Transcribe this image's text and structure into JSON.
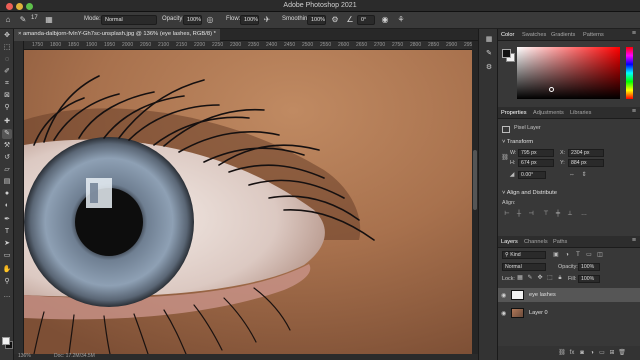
{
  "window": {
    "title": "Adobe Photoshop 2021",
    "traffic_lights": [
      "close",
      "minimize",
      "zoom"
    ]
  },
  "options_bar": {
    "brush_size": "17",
    "mode_label": "Mode:",
    "mode_value": "Normal",
    "opacity_label": "Opacity:",
    "opacity_value": "100%",
    "flow_label": "Flow:",
    "flow_value": "100%",
    "smoothing_label": "Smoothing:",
    "smoothing_value": "100%",
    "angle_value": "0°"
  },
  "document": {
    "tab_title": "amanda-dalbjorn-fvInY-Gh7sc-unsplash.jpg @ 136% (eye lashes, RGB/8) *",
    "ruler_ticks": [
      "1750",
      "1800",
      "1850",
      "1900",
      "1950",
      "2000",
      "2050",
      "2100",
      "2150",
      "2200",
      "2250",
      "2300",
      "2350",
      "2400",
      "2450",
      "2500",
      "2550",
      "2600",
      "2650",
      "2700",
      "2750",
      "2800",
      "2850",
      "2900",
      "2950"
    ],
    "zoom": "136%",
    "status": "Doc: 17.2M/34.5M"
  },
  "color_panel": {
    "tabs": [
      "Color",
      "Swatches",
      "Gradients",
      "Patterns"
    ],
    "active_tab": "Color",
    "foreground": "#111111",
    "background": "#f2f2f2"
  },
  "properties_panel": {
    "tabs": [
      "Properties",
      "Adjustments",
      "Libraries"
    ],
    "active_tab": "Properties",
    "layer_type": "Pixel Layer",
    "transform_title": "Transform",
    "w_label": "W:",
    "w_value": "795 px",
    "h_label": "H:",
    "h_value": "674 px",
    "x_label": "X:",
    "x_value": "2304 px",
    "y_label": "Y:",
    "y_value": "884 px",
    "angle_value": "0.00°",
    "align_title": "Align and Distribute",
    "align_label": "Align:"
  },
  "layers_panel": {
    "tabs": [
      "Layers",
      "Channels",
      "Paths"
    ],
    "active_tab": "Layers",
    "kind_label": "Kind",
    "blend_mode": "Normal",
    "opacity_label": "Opacity:",
    "opacity_value": "100%",
    "lock_label": "Lock:",
    "fill_label": "Fill:",
    "fill_value": "100%",
    "layers": [
      {
        "name": "eye lashes",
        "selected": true,
        "thumb": "white"
      },
      {
        "name": "Layer 0",
        "selected": false,
        "thumb": "photo"
      }
    ]
  },
  "tools": [
    "move-tool",
    "marquee-tool",
    "lasso-tool",
    "quick-select-tool",
    "crop-tool",
    "frame-tool",
    "eyedropper-tool",
    "spot-heal-tool",
    "brush-tool",
    "clone-stamp-tool",
    "history-brush-tool",
    "eraser-tool",
    "gradient-tool",
    "blur-tool",
    "dodge-tool",
    "pen-tool",
    "type-tool",
    "path-select-tool",
    "rectangle-tool",
    "hand-tool",
    "zoom-tool"
  ]
}
